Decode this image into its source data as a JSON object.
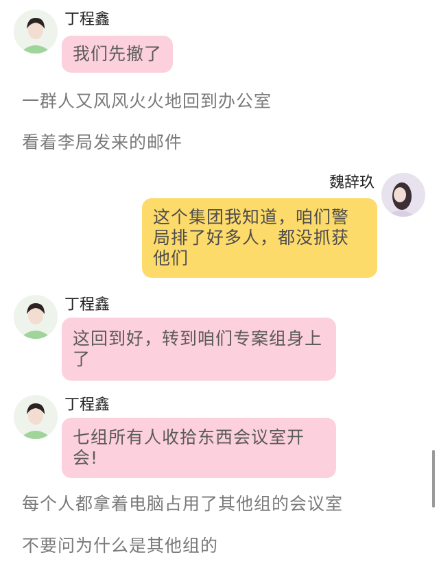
{
  "messages": [
    {
      "speaker": "丁程鑫",
      "text": "我们先撤了"
    },
    {
      "speaker": "魏辞玖",
      "text": "这个集团我知道，咱们警局排了好多人，都没抓获他们"
    },
    {
      "speaker": "丁程鑫",
      "text": "这回到好，转到咱们专案组身上了"
    },
    {
      "speaker": "丁程鑫",
      "text": "七组所有人收拾东西会议室开会!"
    }
  ],
  "narration": [
    "一群人又风风火火地回到办公室",
    "看着李局发来的邮件",
    "每个人都拿着电脑占用了其他组的会议室",
    "不要问为什么是其他组的"
  ],
  "colors": {
    "pink_bubble": "#fdd0dd",
    "yellow_bubble": "#fddb6b",
    "narration_text": "#7a7a7a"
  },
  "icons": [
    "avatar-boy",
    "avatar-girl"
  ]
}
